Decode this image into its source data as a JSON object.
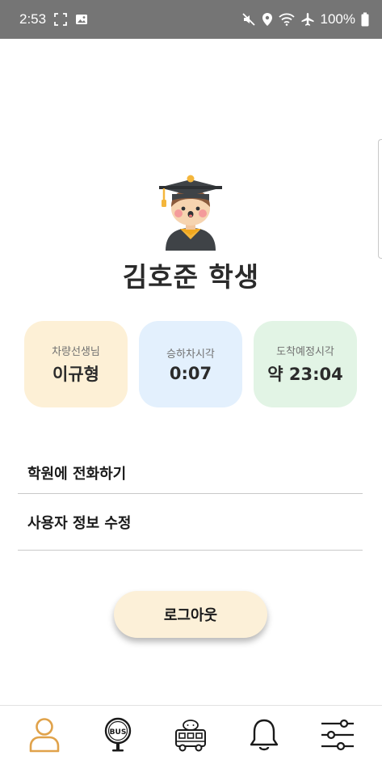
{
  "status_bar": {
    "time": "2:53",
    "battery": "100%",
    "icons": [
      "screenshot-icon",
      "image-icon",
      "mute-icon",
      "location-icon",
      "wifi-icon",
      "airplane-icon",
      "battery-icon"
    ]
  },
  "profile": {
    "name": "김호준 학생",
    "avatar_icon": "graduate-student-avatar"
  },
  "info_cards": [
    {
      "label": "차량선생님",
      "value": "이규형",
      "color": "#fdf0d6"
    },
    {
      "label": "승하차시각",
      "value": "0:07",
      "color": "#e3f0fd"
    },
    {
      "label": "도착예정시각",
      "value": "약 23:04",
      "color": "#e2f4e5"
    }
  ],
  "menu": {
    "call_academy": "학원에 전화하기",
    "edit_user_info": "사용자 정보 수정"
  },
  "logout": {
    "label": "로그아웃"
  },
  "bottom_nav": {
    "items": [
      {
        "icon": "user-icon",
        "active": true,
        "color": "#e0a24a"
      },
      {
        "icon": "bus-stop-sign-icon",
        "text": "BUS"
      },
      {
        "icon": "school-bus-icon"
      },
      {
        "icon": "bell-icon"
      },
      {
        "icon": "sliders-icon"
      }
    ]
  }
}
